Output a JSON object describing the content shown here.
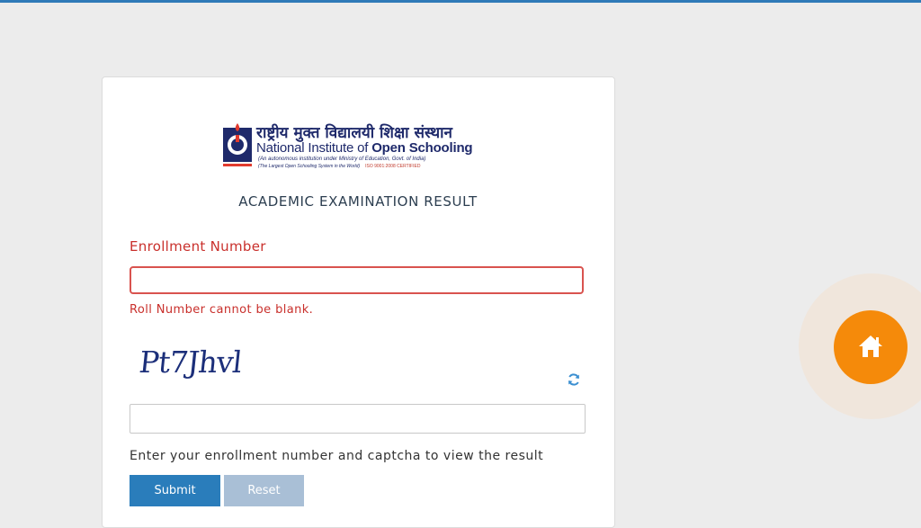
{
  "logo": {
    "hindi": "राष्ट्रीय मुक्त विद्यालयी शिक्षा संस्थान",
    "name_prefix": "National Institute of ",
    "name_bold": "Open Schooling",
    "sub1": "(An autonomous institution under Ministry of Education, Govt. of India)",
    "sub2": "(The Largest Open Schooling System in the World)",
    "iso": "ISO 9001:2008 CERTIFIED"
  },
  "page": {
    "heading": "ACADEMIC EXAMINATION RESULT"
  },
  "form": {
    "enrollment_label": "Enrollment Number",
    "enrollment_value": "",
    "error": "Roll Number cannot be blank.",
    "captcha_text": "Pt7Jhvl",
    "captcha_value": "",
    "help": "Enter your enrollment number and captcha to view the result",
    "submit_label": "Submit",
    "reset_label": "Reset"
  },
  "icons": {
    "refresh": "refresh-icon",
    "home": "home-icon",
    "emblem": "nios-emblem-icon"
  },
  "colors": {
    "primary": "#2a7dbb",
    "error": "#c9302c",
    "home": "#f58a0a",
    "reset": "#a9bfd6"
  }
}
